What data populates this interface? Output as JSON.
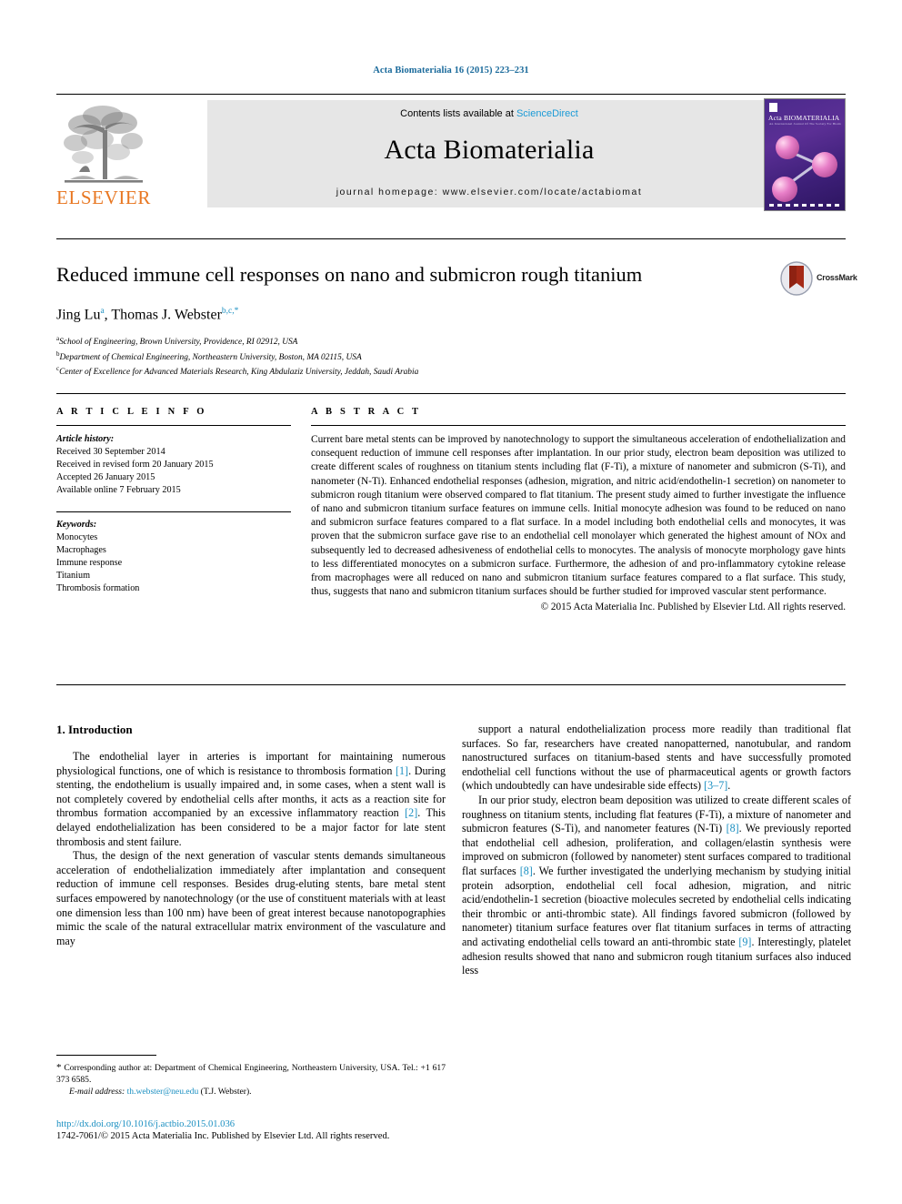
{
  "running_head": "Acta Biomaterialia 16 (2015) 223–231",
  "masthead": {
    "contents_prefix": "Contents lists available at ",
    "sciencedirect": "ScienceDirect",
    "journal_name": "Acta Biomaterialia",
    "homepage": "journal homepage: www.elsevier.com/locate/actabiomat",
    "publisher_logo_text": "ELSEVIER",
    "cover_title": "Acta BIOMATERIALIA",
    "cover_subtitle": "An International Journal Of The Society For Biomaterials",
    "colors": {
      "link": "#1a9ad6",
      "elsevier_orange": "#E87722",
      "running_head": "#1a6a9b",
      "panel_gray": "#e6e6e6"
    }
  },
  "article": {
    "title": "Reduced immune cell responses on nano and submicron rough titanium",
    "crossmark_label": "CrossMark",
    "authors_plain": "Jing Lu",
    "author1": "Jing Lu",
    "author1_sup": "a",
    "author2": ", Thomas J. Webster",
    "author2_sup": "b,c,",
    "author2_star": "*",
    "affiliations": [
      {
        "sup": "a",
        "text": "School of Engineering, Brown University, Providence, RI 02912, USA"
      },
      {
        "sup": "b",
        "text": "Department of Chemical Engineering, Northeastern University, Boston, MA 02115, USA"
      },
      {
        "sup": "c",
        "text": "Center of Excellence for Advanced Materials Research, King Abdulaziz University, Jeddah, Saudi Arabia"
      }
    ]
  },
  "article_info": {
    "heading": "A R T I C L E    I N F O",
    "history_title": "Article history:",
    "history": [
      "Received 30 September 2014",
      "Received in revised form 20 January 2015",
      "Accepted 26 January 2015",
      "Available online 7 February 2015"
    ],
    "keywords_title": "Keywords:",
    "keywords": [
      "Monocytes",
      "Macrophages",
      "Immune response",
      "Titanium",
      "Thrombosis formation"
    ]
  },
  "abstract": {
    "heading": "A B S T R A C T",
    "text": "Current bare metal stents can be improved by nanotechnology to support the simultaneous acceleration of endothelialization and consequent reduction of immune cell responses after implantation. In our prior study, electron beam deposition was utilized to create different scales of roughness on titanium stents including flat (F-Ti), a mixture of nanometer and submicron (S-Ti), and nanometer (N-Ti). Enhanced endothelial responses (adhesion, migration, and nitric acid/endothelin-1 secretion) on nanometer to submicron rough titanium were observed compared to flat titanium. The present study aimed to further investigate the influence of nano and submicron titanium surface features on immune cells. Initial monocyte adhesion was found to be reduced on nano and submicron surface features compared to a flat surface. In a model including both endothelial cells and monocytes, it was proven that the submicron surface gave rise to an endothelial cell monolayer which generated the highest amount of NOx and subsequently led to decreased adhesiveness of endothelial cells to monocytes. The analysis of monocyte morphology gave hints to less differentiated monocytes on a submicron surface. Furthermore, the adhesion of and pro-inflammatory cytokine release from macrophages were all reduced on nano and submicron titanium surface features compared to a flat surface. This study, thus, suggests that nano and submicron titanium surfaces should be further studied for improved vascular stent performance.",
    "copyright": "© 2015 Acta Materialia Inc. Published by Elsevier Ltd. All rights reserved."
  },
  "introduction": {
    "heading": "1. Introduction",
    "left_paragraphs": [
      "The endothelial layer in arteries is important for maintaining numerous physiological functions, one of which is resistance to thrombosis formation [1]. During stenting, the endothelium is usually impaired and, in some cases, when a stent wall is not completely covered by endothelial cells after months, it acts as a reaction site for thrombus formation accompanied by an excessive inflammatory reaction [2]. This delayed endothelialization has been considered to be a major factor for late stent thrombosis and stent failure.",
      "Thus, the design of the next generation of vascular stents demands simultaneous acceleration of endothelialization immediately after implantation and consequent reduction of immune cell responses. Besides drug-eluting stents, bare metal stent surfaces empowered by nanotechnology (or the use of constituent materials with at least one dimension less than 100 nm) have been of great interest because nanotopographies mimic the scale of the natural extracellular matrix environment of the vasculature and may"
    ],
    "right_paragraphs": [
      "support a natural endothelialization process more readily than traditional flat surfaces. So far, researchers have created nanopatterned, nanotubular, and random nanostructured surfaces on titanium-based stents and have successfully promoted endothelial cell functions without the use of pharmaceutical agents or growth factors (which undoubtedly can have undesirable side effects) [3–7].",
      "In our prior study, electron beam deposition was utilized to create different scales of roughness on titanium stents, including flat features (F-Ti), a mixture of nanometer and submicron features (S-Ti), and nanometer features (N-Ti) [8]. We previously reported that endothelial cell adhesion, proliferation, and collagen/elastin synthesis were improved on submicron (followed by nanometer) stent surfaces compared to traditional flat surfaces [8]. We further investigated the underlying mechanism by studying initial protein adsorption, endothelial cell focal adhesion, migration, and nitric acid/endothelin-1 secretion (bioactive molecules secreted by endothelial cells indicating their thrombic or anti-thrombic state). All findings favored submicron (followed by nanometer) titanium surface features over flat titanium surfaces in terms of attracting and activating endothelial cells toward an anti-thrombic state [9]. Interestingly, platelet adhesion results showed that nano and submicron rough titanium surfaces also induced less"
    ],
    "refs_left": [
      "[1]",
      "[2]"
    ],
    "refs_right": [
      "[3–7]",
      "[8]",
      "[9]"
    ]
  },
  "footnote": {
    "star": "*",
    "corresponding": "Corresponding author at: Department of Chemical Engineering, Northeastern University, USA. Tel.: +1 617 373 6585.",
    "email_label": "E-mail address:",
    "email": "th.webster@neu.edu",
    "email_owner": "(T.J. Webster)."
  },
  "footer": {
    "doi": "http://dx.doi.org/10.1016/j.actbio.2015.01.036",
    "issn_line": "1742-7061/© 2015 Acta Materialia Inc. Published by Elsevier Ltd. All rights reserved."
  }
}
